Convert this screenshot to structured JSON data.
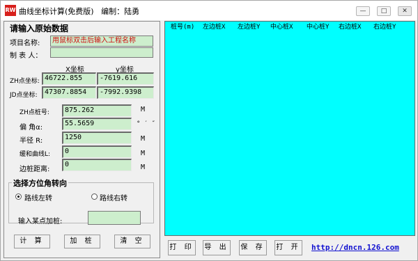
{
  "window": {
    "title": "曲线坐标计算(免费版)   编制：陆勇",
    "icon_text": "RW",
    "buttons": {
      "minimize": "—",
      "maximize": "□",
      "close": "✕"
    }
  },
  "input_panel": {
    "heading": "请输入原始数据",
    "project_name_label": "项目名称:",
    "project_name_value": "用鼠标双击后输入工程名称",
    "preparer_label": "制 表 人：",
    "preparer_value": "",
    "x_header": "X坐标",
    "y_header": "y坐标",
    "zh_label": "ZH点坐标:",
    "zh_x": "46722.855",
    "zh_y": "-7619.616",
    "jd_label": "JD点坐标:",
    "jd_x": "47307.8854",
    "jd_y": "-7992.9398",
    "zh_station_label": "ZH点桩号:",
    "zh_station_value": "875.262",
    "zh_station_unit": "M",
    "deflection_label": "偏  角α:",
    "deflection_value": "55.5659",
    "deflection_unit": "° ′ ″",
    "radius_label": "半径  R:",
    "radius_value": "1250",
    "radius_unit": "M",
    "transition_label": "缓和曲线L:",
    "transition_value": "0",
    "transition_unit": "M",
    "side_distance_label": "边桩距离:",
    "side_distance_value": "0",
    "side_distance_unit": "M"
  },
  "direction": {
    "heading": "选择方位角转向",
    "left_label": "路线左转",
    "left_checked": true,
    "right_label": "路线右转",
    "right_checked": false
  },
  "add_station": {
    "label": "输入某点加桩:",
    "value": ""
  },
  "actions": {
    "calculate": "计 算",
    "add_stake": "加 桩",
    "clear": "清 空"
  },
  "grid": {
    "columns": [
      "桩号(m)",
      "左边桩X",
      "左边桩Y",
      "中心桩X",
      "中心桩Y",
      "右边桩X",
      "右边桩Y"
    ],
    "background": "#00ffff"
  },
  "bottom_bar": {
    "print": "打 印",
    "export": "导 出",
    "save": "保 存",
    "open": "打 开",
    "link": "http://dncn.126.com"
  }
}
